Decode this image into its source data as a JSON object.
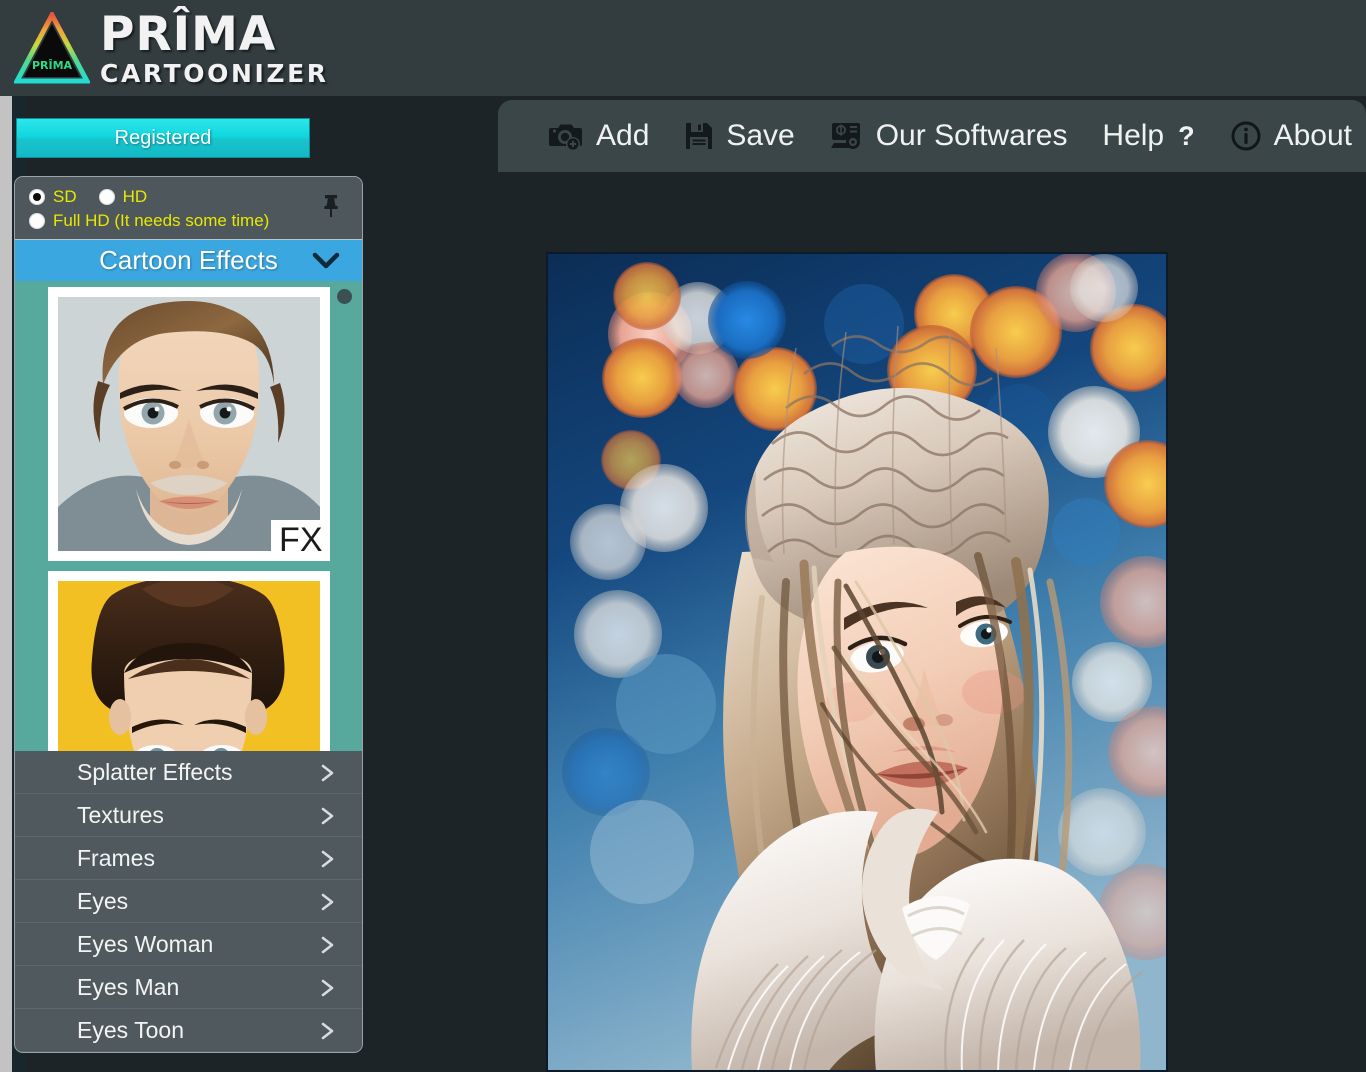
{
  "app": {
    "logo_primary": "PRÎMA",
    "logo_secondary": "CARTOONIZER",
    "logo_mark_text": "PRÎMA"
  },
  "toolbar": {
    "items": [
      {
        "label": "Add",
        "icon": "camera-add-icon"
      },
      {
        "label": "Save",
        "icon": "floppy-disk-icon"
      },
      {
        "label": "Our Softwares",
        "icon": "monitor-search-icon"
      },
      {
        "label": "Help",
        "icon": "question-mark-icon"
      },
      {
        "label": "About",
        "icon": "info-circle-icon"
      }
    ],
    "help_suffix": "?"
  },
  "sidebar": {
    "registered_label": "Registered",
    "resolution": {
      "options": [
        {
          "label": "SD",
          "selected": true
        },
        {
          "label": "HD",
          "selected": false
        },
        {
          "label": "Full HD (It needs some time)",
          "selected": false
        }
      ],
      "pin_icon": "pushpin-icon"
    },
    "section": {
      "title": "Cartoon Effects",
      "chevron": "chevron-down-icon"
    },
    "thumbnails": [
      {
        "name": "cartoon-effect-man-portrait",
        "badge": "FX",
        "bg": "#ffffff"
      },
      {
        "name": "cartoon-effect-man-hat",
        "badge": "",
        "bg": "#ffffff"
      }
    ],
    "menu": [
      {
        "label": "Splatter Effects",
        "arrow": "chevron-right-icon"
      },
      {
        "label": "Textures",
        "arrow": "chevron-right-icon"
      },
      {
        "label": "Frames",
        "arrow": "chevron-right-icon"
      },
      {
        "label": "Eyes",
        "arrow": "chevron-right-icon"
      },
      {
        "label": "Eyes Woman",
        "arrow": "chevron-right-icon"
      },
      {
        "label": "Eyes Man",
        "arrow": "chevron-right-icon"
      },
      {
        "label": "Eyes Toon",
        "arrow": "chevron-right-icon"
      }
    ]
  },
  "preview": {
    "name": "cartoonized-photo-woman-winter-hat",
    "description": "Cartoonized portrait of a woman in a knitted fur hat with blue bokeh background"
  },
  "colors": {
    "header_bg": "#333d40",
    "app_bg": "#1c2428",
    "accent_cyan": "#12c4cd",
    "section_blue": "#3ba7e0",
    "thumb_teal": "#57a99d",
    "menu_gray": "#50595d",
    "radio_yellow": "#e8e800"
  }
}
